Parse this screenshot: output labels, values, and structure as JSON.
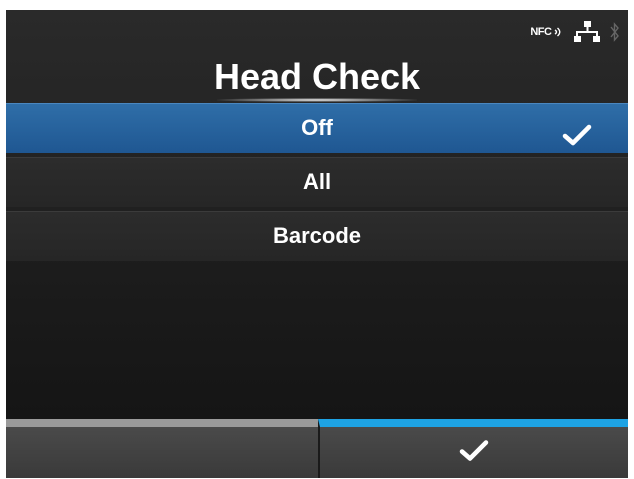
{
  "status_bar": {
    "nfc_label": "NFC",
    "icons": [
      "nfc-icon",
      "network-icon",
      "bluetooth-icon"
    ]
  },
  "title": "Head Check",
  "menu": {
    "items": [
      {
        "label": "Off",
        "selected": true
      },
      {
        "label": "All",
        "selected": false
      },
      {
        "label": "Barcode",
        "selected": false
      }
    ]
  },
  "softkeys": {
    "left": {
      "label": ""
    },
    "right": {
      "icon": "check-icon"
    }
  },
  "colors": {
    "selected_row": "#2f6ea8",
    "accent_blue": "#1ea3e4",
    "left_key_accent": "#9a9a9a",
    "background": "#1e1e1e",
    "text": "#ffffff"
  }
}
